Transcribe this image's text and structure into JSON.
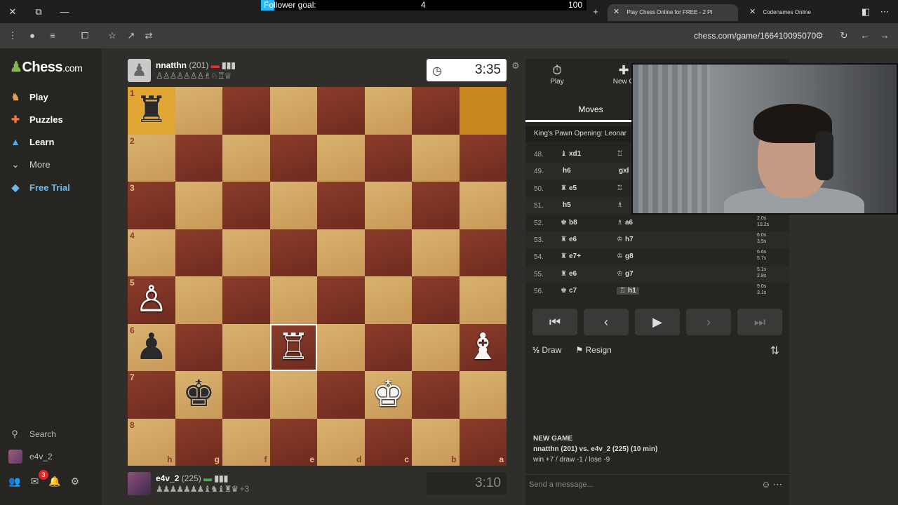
{
  "browser": {
    "follower_goal": {
      "label": "Follower goal:",
      "current": "4",
      "target": "100",
      "progress": 0.04
    },
    "tabs": [
      {
        "title": "Play Chess Online for FREE - 2 Pl",
        "active": true
      },
      {
        "title": "Codenames Online",
        "active": false
      }
    ],
    "new_tab": "+",
    "url": "chess.com/game/166410095070"
  },
  "sidebar": {
    "logo_text": "Chess",
    "logo_suffix": ".com",
    "items": [
      {
        "label": "Play",
        "icon": "pawn-icon"
      },
      {
        "label": "Puzzles",
        "icon": "puzzle-icon"
      },
      {
        "label": "Learn",
        "icon": "graduation-cap-icon"
      },
      {
        "label": "More",
        "icon": "chevron-down-icon"
      },
      {
        "label": "Free Trial",
        "icon": "diamond-icon"
      }
    ],
    "search_label": "Search",
    "username": "e4v_2",
    "notification_count": "3"
  },
  "top_player": {
    "name": "nnatthn",
    "rating": "(201)",
    "clock": "3:35"
  },
  "bottom_player": {
    "name": "e4v_2",
    "rating": "(225)",
    "material": "+3",
    "clock": "3:10"
  },
  "board": {
    "ranks": [
      "1",
      "2",
      "3",
      "4",
      "5",
      "6",
      "7",
      "8"
    ],
    "files": [
      "h",
      "g",
      "f",
      "e",
      "d",
      "c",
      "b",
      "a"
    ]
  },
  "panel": {
    "play_tab": "Play",
    "new_game_tab": "New G",
    "moves_tab": "Moves",
    "opening": "King's Pawn Opening: Leonar",
    "moves": [
      {
        "num": "48.",
        "w": "xd1",
        "wp": "♝",
        "b": "",
        "bp": "♖",
        "t1": "",
        "t2": ""
      },
      {
        "num": "49.",
        "w": "h6",
        "wp": "",
        "b": "gxl",
        "bp": "",
        "t1": "",
        "t2": ""
      },
      {
        "num": "50.",
        "w": "e5",
        "wp": "♜",
        "b": "",
        "bp": "♖",
        "t1": "",
        "t2": ""
      },
      {
        "num": "51.",
        "w": "h5",
        "wp": "",
        "b": "",
        "bp": "♗",
        "t1": "",
        "t2": ""
      },
      {
        "num": "52.",
        "w": "b8",
        "wp": "♚",
        "b": "a6",
        "bp": "♗",
        "t1": "2.0s",
        "t2": "10.2s"
      },
      {
        "num": "53.",
        "w": "e6",
        "wp": "♜",
        "b": "h7",
        "bp": "♔",
        "t1": "6.0s",
        "t2": "3.5s"
      },
      {
        "num": "54.",
        "w": "e7+",
        "wp": "♜",
        "b": "g8",
        "bp": "♔",
        "t1": "6.6s",
        "t2": "5.7s"
      },
      {
        "num": "55.",
        "w": "e6",
        "wp": "♜",
        "b": "g7",
        "bp": "♔",
        "t1": "5.1s",
        "t2": "2.8s"
      },
      {
        "num": "56.",
        "w": "c7",
        "wp": "♚",
        "b": "h1",
        "bp": "♖",
        "t1": "9.0s",
        "t2": "3.1s"
      }
    ],
    "draw_label": "Draw",
    "draw_prefix": "½",
    "resign_label": "Resign",
    "new_game_title": "NEW GAME",
    "new_game_line1": "nnatthn (201) vs. e4v_2 (225) (10 min)",
    "new_game_line2": "win +7 / draw -1 / lose -9",
    "chat_placeholder": "Send a message..."
  }
}
